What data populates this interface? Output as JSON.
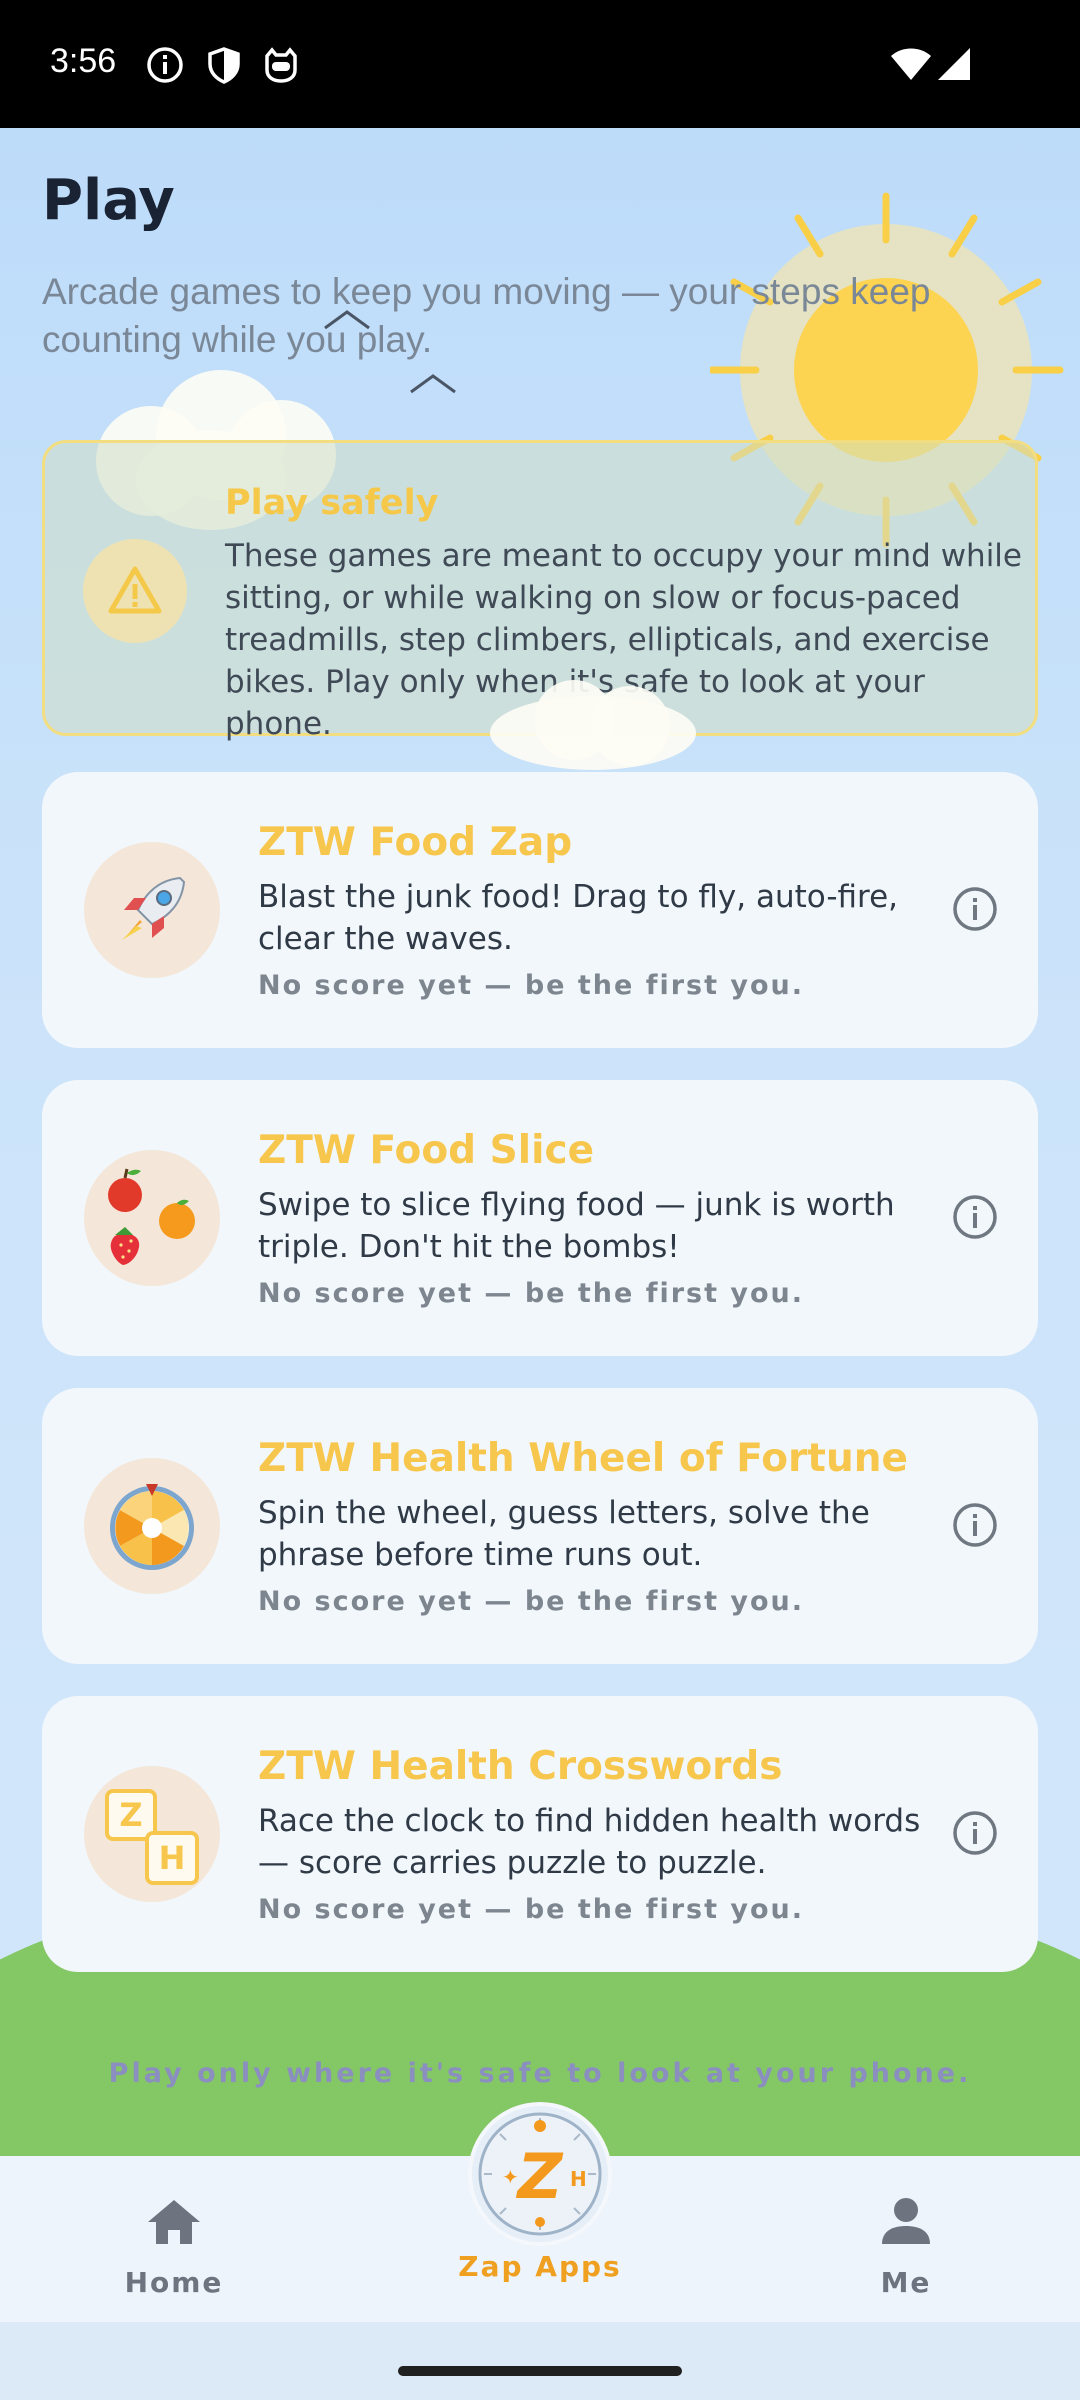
{
  "status_bar": {
    "time": "3:56",
    "icons": [
      "info-icon",
      "shield-icon",
      "cat-face-icon",
      "wifi-icon",
      "signal-icon"
    ]
  },
  "header": {
    "title": "Play",
    "subtitle": "Arcade games to keep you moving — your steps keep counting while you play."
  },
  "safety": {
    "icon": "warning-icon",
    "heading": "Play safely",
    "body": "These games are meant to occupy your mind while sitting, or while walking on slow or focus-paced treadmills, step climbers, ellipticals, and exercise bikes. Play only when it's safe to look at your phone."
  },
  "games": [
    {
      "name": "ZTW Food Zap",
      "description": "Blast the junk food! Drag to fly, auto-fire, clear the waves.",
      "score": "No score yet — be the first you.",
      "icon": "rocket-icon"
    },
    {
      "name": "ZTW Food Slice",
      "description": "Swipe to slice flying food — junk is worth triple. Don't hit the bombs!",
      "score": "No score yet — be the first you.",
      "icon": "fruit-icon"
    },
    {
      "name": "ZTW Health Wheel of Fortune",
      "description": "Spin the wheel, guess letters, solve the phrase before time runs out.",
      "score": "No score yet — be the first you.",
      "icon": "wheel-icon"
    },
    {
      "name": "ZTW Health Crosswords",
      "description": "Race the clock to find hidden health words — score carries puzzle to puzzle.",
      "score": "No score yet — be the first you.",
      "icon": "letter-tiles-icon",
      "tile_letters": [
        "Z",
        "H"
      ]
    }
  ],
  "footer_note": "Play only where it's safe to look at your phone.",
  "nav": {
    "home": "Home",
    "zap_apps": "Zap Apps",
    "me": "Me",
    "zap_logo_letter": "Z",
    "active": "zap_apps"
  },
  "colors": {
    "accent": "#f7c64d",
    "active_nav": "#f0a020",
    "sky": "#bddcfa",
    "grass": "#84c765"
  }
}
